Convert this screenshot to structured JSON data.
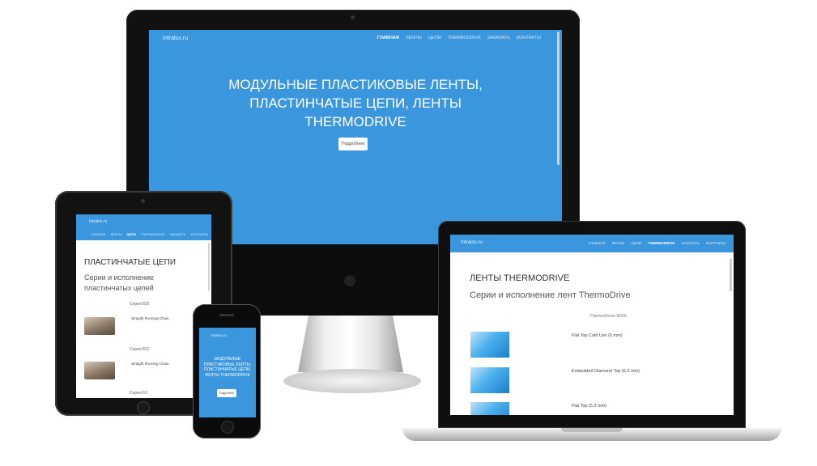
{
  "brand": "Intralox.ru",
  "colors": {
    "accent": "#3a97dd",
    "text_dark": "#333333"
  },
  "desktop": {
    "nav": [
      "ГЛАВНАЯ",
      "ЛЕНТЫ",
      "ЦЕПИ",
      "THERMODRIVE",
      "ЗАКАЗАТЬ",
      "КОНТАКТЫ"
    ],
    "hero_lines": [
      "МОДУЛЬНЫЕ ПЛАСТИКОВЫЕ ЛЕНТЫ,",
      "ПЛАСТИНЧАТЫЕ ЦЕПИ, ЛЕНТЫ",
      "THERMODRIVE"
    ],
    "button": "Подробнее"
  },
  "tablet": {
    "brand": "Intralox.ru",
    "nav": [
      "ГЛАВНАЯ",
      "ЛЕНТЫ",
      "ЦЕПИ",
      "THERMODRIVE",
      "ЗАКАЗАТЬ",
      "КОНТАКТЫ"
    ],
    "heading": "ПЛАСТИНЧАТЫЕ ЦЕПИ",
    "subheading": "Серии и исполнение пластинчатых цепей",
    "items": [
      {
        "series": "Серия 820",
        "name": "Straight Running Chain"
      },
      {
        "series": "Серия 821",
        "name": "Straight Running Chain"
      },
      {
        "series": "Серия 63",
        "name": ""
      }
    ]
  },
  "phone": {
    "brand": "Intralox.ru",
    "title": "МОДУЛЬНЫЕ ПЛАСТИКОВЫЕ ЛЕНТЫ, ПЛАСТИНЧАТЫЕ ЦЕПИ, ЛЕНТЫ THERMODRIVE",
    "button": "Подробнее"
  },
  "laptop": {
    "brand": "Intralox.ru",
    "nav": [
      "ГЛАВНАЯ",
      "ЛЕНТЫ",
      "ЦЕПИ",
      "THERMODRIVE",
      "ЗАКАЗАТЬ",
      "КОНТАКТЫ"
    ],
    "heading": "ЛЕНТЫ THERMODRIVE",
    "subheading": "Серии и исполнение лент ThermoDrive",
    "series_label": "ThermoDrive 8026",
    "items": [
      "Flat Top Cold Use (6 mm)",
      "Embedded Diamond Top (6.3 mm)",
      "Flat Top (5.3 mm)"
    ]
  }
}
